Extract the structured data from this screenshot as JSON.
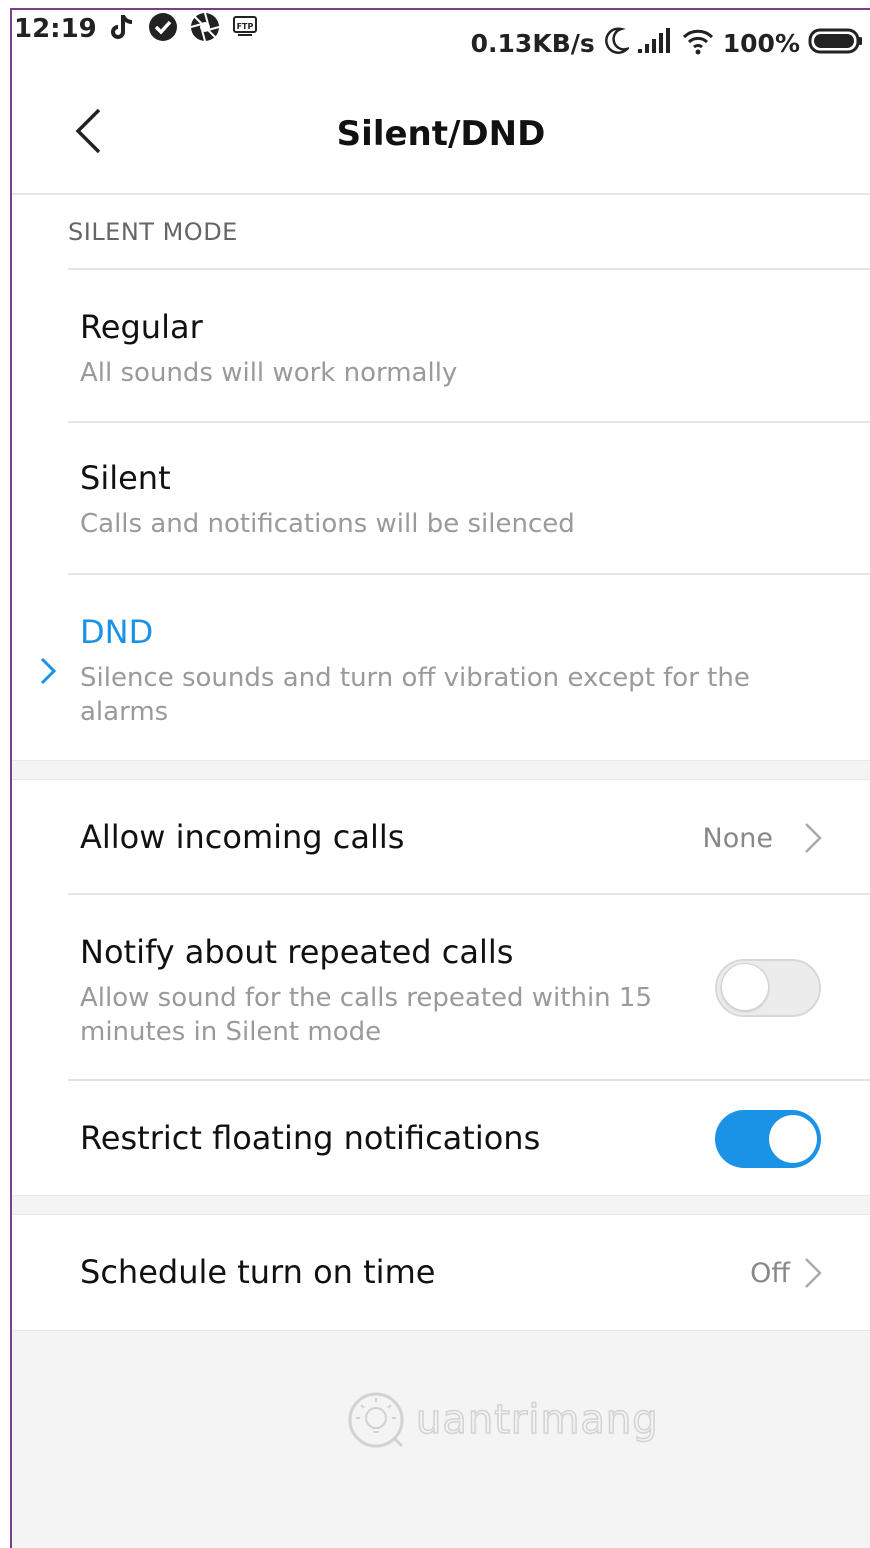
{
  "status_bar": {
    "time": "12:19",
    "left_icons": [
      "tiktok-icon",
      "check-circle-icon",
      "aperture-icon",
      "ftp-icon"
    ],
    "network_speed": "0.13KB/s",
    "right_icons": [
      "moon-icon",
      "signal-icon",
      "wifi-icon"
    ],
    "battery_percent": "100%"
  },
  "header": {
    "title": "Silent/DND",
    "back_icon": "chevron-left-icon"
  },
  "silent_mode": {
    "section_label": "SILENT MODE",
    "options": [
      {
        "title": "Regular",
        "subtitle": "All sounds will work normally",
        "selected": false
      },
      {
        "title": "Silent",
        "subtitle": "Calls and notifications will be silenced",
        "selected": false
      },
      {
        "title": "DND",
        "subtitle": "Silence sounds and turn off vibration except for the alarms",
        "selected": true
      }
    ]
  },
  "settings": {
    "allow_incoming_calls": {
      "title": "Allow incoming calls",
      "value": "None"
    },
    "notify_repeated_calls": {
      "title": "Notify about repeated calls",
      "subtitle": "Allow sound for the calls repeated within 15 minutes in Silent mode",
      "enabled": false
    },
    "restrict_floating": {
      "title": "Restrict floating notifications",
      "enabled": true
    },
    "schedule": {
      "title": "Schedule turn on time",
      "value": "Off"
    }
  },
  "colors": {
    "accent": "#1a93e6",
    "frame_border": "#7b3f8c"
  }
}
